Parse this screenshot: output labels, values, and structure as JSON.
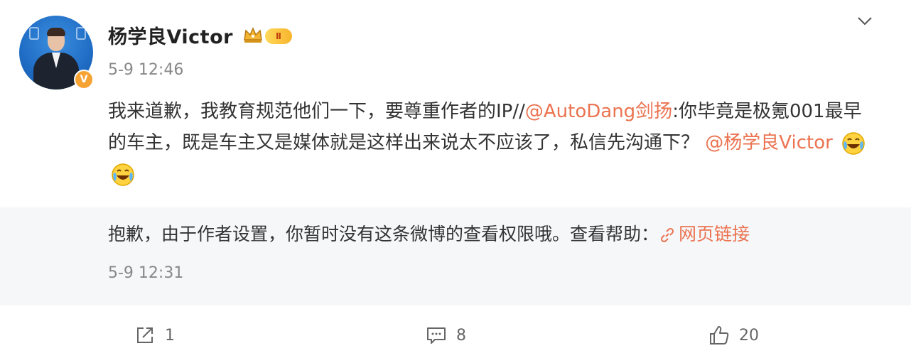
{
  "post": {
    "author": "杨学良Victor",
    "level": "Ⅱ",
    "verified_mark": "V",
    "time": "5-9 12:46",
    "text_part1": "我来道歉，我教育规范他们一下，要尊重作者的IP//",
    "mention1": "@AutoDang剑扬",
    "text_part2": ":你毕竟是极氪001最早的车主，既是车主又是媒体就是这样出来说太不应该了，私信先沟通下？",
    "mention2": "@杨学良Victor",
    "emojis": [
      "laugh-cry-emoji",
      "laugh-cry-emoji"
    ]
  },
  "repost": {
    "message": "抱歉，由于作者设置，你暂时没有这条微博的查看权限哦。查看帮助：",
    "link_label": "网页链接",
    "time": "5-9 12:31"
  },
  "actions": {
    "share_count": "1",
    "comment_count": "8",
    "like_count": "20"
  },
  "colors": {
    "accent": "#eb7350",
    "muted": "#888888",
    "repost_bg": "#f6f7f9"
  }
}
